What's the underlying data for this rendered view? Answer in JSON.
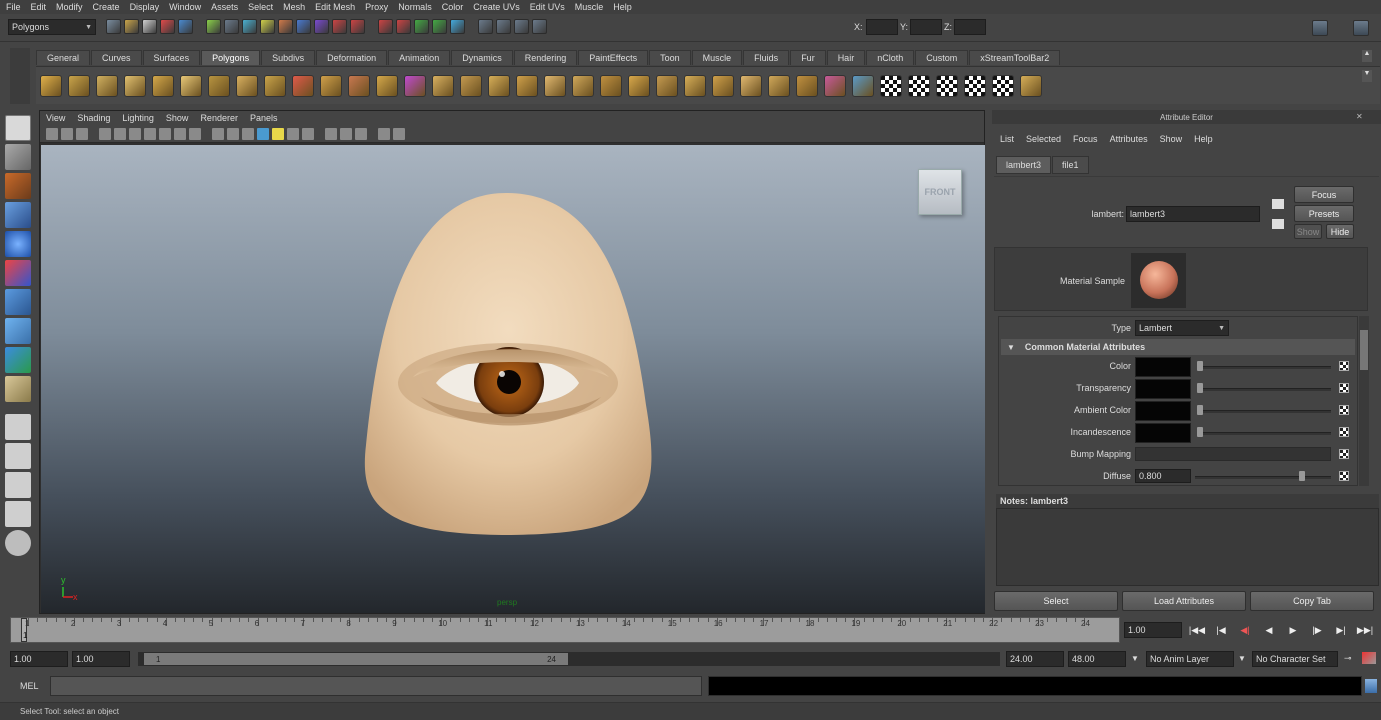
{
  "menubar": [
    "File",
    "Edit",
    "Modify",
    "Create",
    "Display",
    "Window",
    "Assets",
    "Select",
    "Mesh",
    "Edit Mesh",
    "Proxy",
    "Normals",
    "Color",
    "Create UVs",
    "Edit UVs",
    "Muscle",
    "Help"
  ],
  "status": {
    "menuset": "Polygons",
    "x_label": "X:",
    "y_label": "Y:",
    "z_label": "Z:"
  },
  "shelf_tabs": [
    "General",
    "Curves",
    "Surfaces",
    "Polygons",
    "Subdivs",
    "Deformation",
    "Animation",
    "Dynamics",
    "Rendering",
    "PaintEffects",
    "Toon",
    "Muscle",
    "Fluids",
    "Fur",
    "Hair",
    "nCloth",
    "Custom",
    "xStreamToolBar2"
  ],
  "shelf_active": "Polygons",
  "viewport": {
    "menu": [
      "View",
      "Shading",
      "Lighting",
      "Show",
      "Renderer",
      "Panels"
    ],
    "view_cube_label": "FRONT",
    "axis_y": "y",
    "axis_x": "x",
    "camera_label": "persp"
  },
  "attribute_editor": {
    "title": "Attribute Editor",
    "menu": [
      "List",
      "Selected",
      "Focus",
      "Attributes",
      "Show",
      "Help"
    ],
    "tabs": [
      "lambert3",
      "file1"
    ],
    "node_label": "lambert:",
    "node_value": "lambert3",
    "buttons": {
      "focus": "Focus",
      "presets": "Presets",
      "show": "Show",
      "hide": "Hide"
    },
    "material_sample_label": "Material Sample",
    "type_label": "Type",
    "type_value": "Lambert",
    "section_title": "Common Material Attributes",
    "attributes": [
      {
        "label": "Color"
      },
      {
        "label": "Transparency"
      },
      {
        "label": "Ambient Color"
      },
      {
        "label": "Incandescence"
      },
      {
        "label": "Bump Mapping"
      },
      {
        "label": "Diffuse",
        "value": "0.800"
      }
    ],
    "notes_label": "Notes: lambert3",
    "bottom_buttons": [
      "Select",
      "Load Attributes",
      "Copy Tab"
    ]
  },
  "timeline": {
    "ticks": [
      "1",
      "2",
      "3",
      "4",
      "5",
      "6",
      "7",
      "8",
      "9",
      "10",
      "11",
      "12",
      "13",
      "14",
      "15",
      "16",
      "17",
      "18",
      "19",
      "20",
      "21",
      "22",
      "23",
      "24"
    ],
    "current_frame": "1",
    "current_field": "1.00"
  },
  "range": {
    "start_time": "1.00",
    "start_range": "1.00",
    "slider_start": "1",
    "slider_end": "24",
    "end_range": "24.00",
    "end_time": "48.00",
    "anim_layer": "No Anim Layer",
    "character_set": "No Character Set"
  },
  "command": {
    "label": "MEL"
  },
  "help_line": "Select Tool: select an object",
  "colors": {
    "skin": "#e6c9a5",
    "iris": "#8a4a12",
    "bg_top": "#a9b4c0",
    "bg_bottom": "#23272c"
  }
}
